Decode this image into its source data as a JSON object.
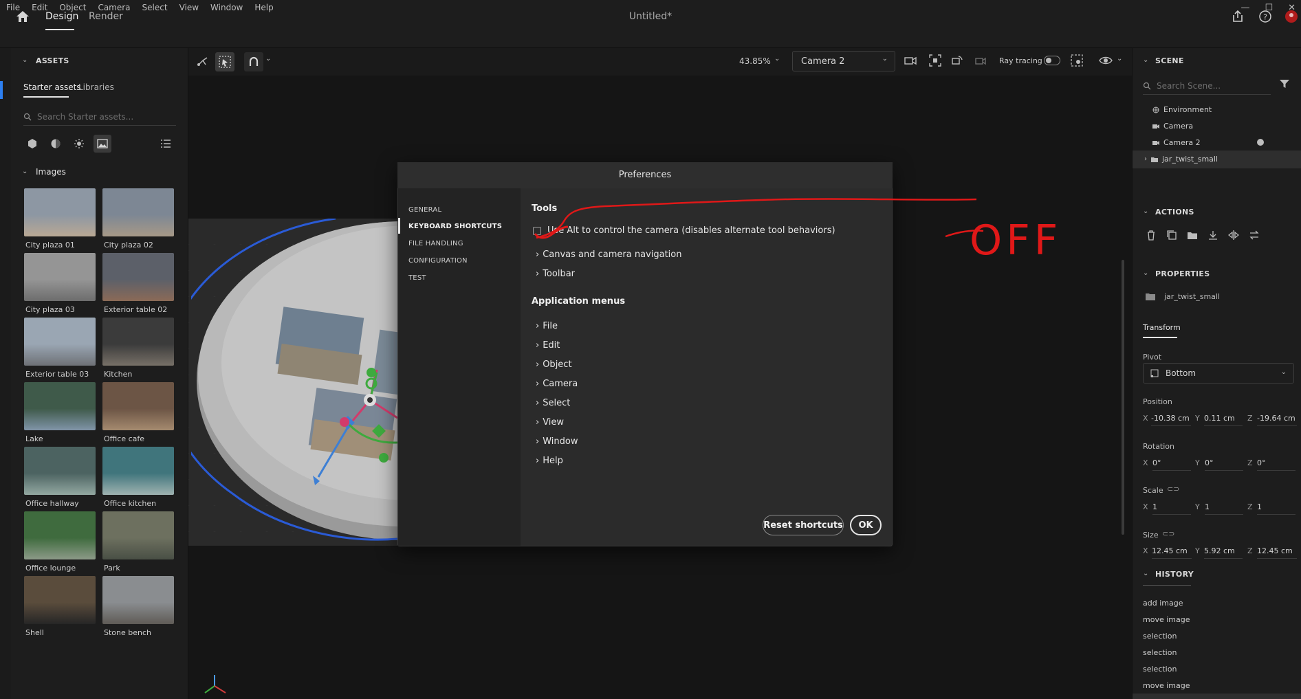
{
  "menubar": {
    "items": [
      "File",
      "Edit",
      "Object",
      "Camera",
      "Select",
      "View",
      "Window",
      "Help"
    ]
  },
  "header": {
    "tabs": [
      "Design",
      "Render"
    ],
    "doc_title": "Untitled*"
  },
  "assets": {
    "title": "ASSETS",
    "subtabs": [
      "Starter assets",
      "Libraries"
    ],
    "search_placeholder": "Search Starter assets...",
    "section": "Images",
    "images": [
      {
        "label": "City plaza 01",
        "c1": "#8d97a3",
        "c2": "#b9a894"
      },
      {
        "label": "City plaza 02",
        "c1": "#7d8794",
        "c2": "#a79987"
      },
      {
        "label": "City plaza 03",
        "c1": "#959595",
        "c2": "#6d6d6d"
      },
      {
        "label": "Exterior table 02",
        "c1": "#5c6069",
        "c2": "#8b6a57"
      },
      {
        "label": "Exterior table 03",
        "c1": "#9aa6b3",
        "c2": "#6e7176"
      },
      {
        "label": "Kitchen",
        "c1": "#3b3b3b",
        "c2": "#777067"
      },
      {
        "label": "Lake",
        "c1": "#3f5a4a",
        "c2": "#8094a8"
      },
      {
        "label": "Office cafe",
        "c1": "#6c5545",
        "c2": "#a58a6f"
      },
      {
        "label": "Office hallway",
        "c1": "#4c6361",
        "c2": "#93a8a1"
      },
      {
        "label": "Office kitchen",
        "c1": "#40757c",
        "c2": "#9fb2b0"
      },
      {
        "label": "Office lounge",
        "c1": "#3f6b3e",
        "c2": "#8c9a88"
      },
      {
        "label": "Park",
        "c1": "#6d705f",
        "c2": "#494f45"
      },
      {
        "label": "Shell",
        "c1": "#5a4c3c",
        "c2": "#262626"
      },
      {
        "label": "Stone bench",
        "c1": "#8a8d90",
        "c2": "#5f5b56"
      }
    ]
  },
  "viewport": {
    "zoom": "43.85%",
    "camera": "Camera 2",
    "ray_tracing_label": "Ray tracing"
  },
  "scene": {
    "title": "SCENE",
    "search_placeholder": "Search Scene...",
    "items": [
      "Environment",
      "Camera",
      "Camera 2",
      "jar_twist_small"
    ]
  },
  "actions": {
    "title": "ACTIONS"
  },
  "properties": {
    "title": "PROPERTIES",
    "object": "jar_twist_small",
    "tab": "Transform",
    "pivot_label": "Pivot",
    "pivot_value": "Bottom",
    "position_label": "Position",
    "position": {
      "x": "-10.38 cm",
      "y": "0.11 cm",
      "z": "-19.64 cm"
    },
    "rotation_label": "Rotation",
    "rotation": {
      "x": "0°",
      "y": "0°",
      "z": "0°"
    },
    "scale_label": "Scale",
    "scale": {
      "x": "1",
      "y": "1",
      "z": "1"
    },
    "size_label": "Size",
    "size": {
      "x": "12.45 cm",
      "y": "5.92 cm",
      "z": "12.45 cm"
    },
    "axes": {
      "x": "X",
      "y": "Y",
      "z": "Z"
    }
  },
  "history": {
    "title": "HISTORY",
    "items": [
      "add image",
      "move image",
      "selection",
      "selection",
      "selection",
      "move image"
    ]
  },
  "dialog": {
    "title": "Preferences",
    "nav": [
      "GENERAL",
      "KEYBOARD SHORTCUTS",
      "FILE HANDLING",
      "CONFIGURATION",
      "TEST"
    ],
    "tools_heading": "Tools",
    "alt_option": "Use Alt to control the camera (disables alternate tool behaviors)",
    "tool_groups": [
      "Canvas and camera navigation",
      "Toolbar"
    ],
    "menus_heading": "Application menus",
    "menus": [
      "File",
      "Edit",
      "Object",
      "Camera",
      "Select",
      "View",
      "Window",
      "Help"
    ],
    "reset_label": "Reset shortcuts",
    "ok_label": "OK"
  },
  "annotation": {
    "text": "OFF",
    "color": "#e01818"
  }
}
